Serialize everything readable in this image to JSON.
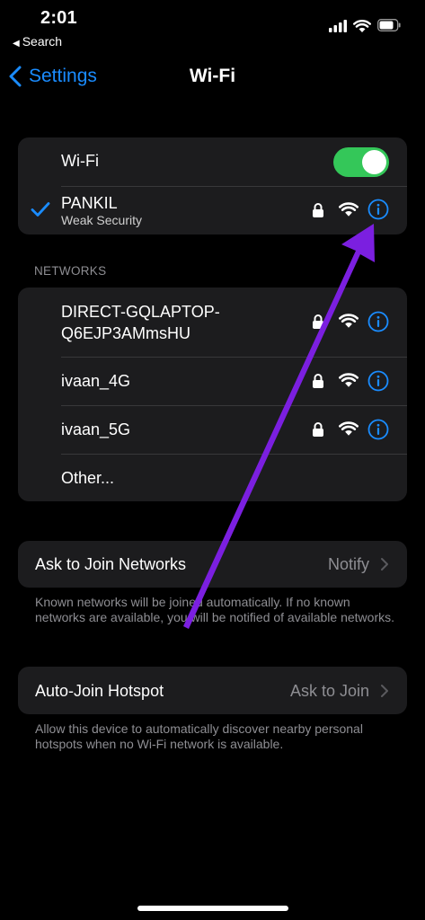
{
  "status_bar": {
    "time": "2:01",
    "back_app": "Search"
  },
  "nav": {
    "back_label": "Settings",
    "title": "Wi-Fi"
  },
  "wifi_toggle": {
    "label": "Wi-Fi",
    "on": true
  },
  "connected": {
    "name": "PANKIL",
    "subtitle": "Weak Security"
  },
  "networks_header": "NETWORKS",
  "networks": [
    {
      "name_line1": "DIRECT-GQLAPTOP-",
      "name_line2": "Q6EJP3AMmsHU"
    },
    {
      "name": "ivaan_4G"
    },
    {
      "name": "ivaan_5G"
    },
    {
      "name": "Other..."
    }
  ],
  "ask_to_join": {
    "label": "Ask to Join Networks",
    "value": "Notify",
    "footer": "Known networks will be joined automatically. If no known networks are available, you will be notified of available networks."
  },
  "auto_join": {
    "label": "Auto-Join Hotspot",
    "value": "Ask to Join",
    "footer": "Allow this device to automatically discover nearby personal hotspots when no Wi-Fi network is available."
  },
  "colors": {
    "accent": "#1a8cff",
    "toggle_on": "#34c759",
    "annotation_arrow": "#7b1fe0"
  }
}
